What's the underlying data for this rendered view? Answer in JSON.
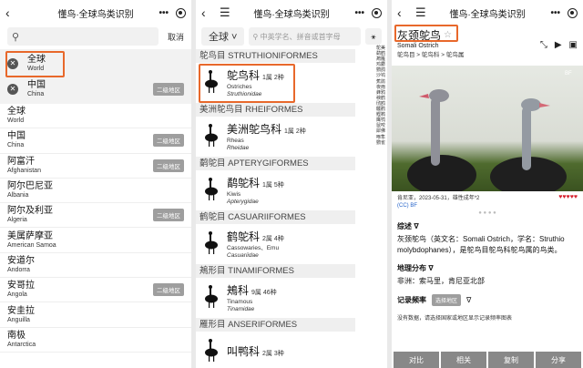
{
  "app_title": "懂鸟·全球鸟类识别",
  "screen1": {
    "search_placeholder": "",
    "cancel": "取消",
    "selected": [
      {
        "cn": "全球",
        "en": "World"
      },
      {
        "cn": "中国",
        "en": "China",
        "tag": "二级地区"
      }
    ],
    "regions": [
      {
        "cn": "全球",
        "en": "World"
      },
      {
        "cn": "中国",
        "en": "China",
        "tag": "二级地区"
      },
      {
        "cn": "阿富汗",
        "en": "Afghanistan",
        "tag": "二级地区"
      },
      {
        "cn": "阿尔巴尼亚",
        "en": "Albania"
      },
      {
        "cn": "阿尔及利亚",
        "en": "Algeria",
        "tag": "二级地区"
      },
      {
        "cn": "美属萨摩亚",
        "en": "American Samoa"
      },
      {
        "cn": "安道尔",
        "en": "Andorra"
      },
      {
        "cn": "安哥拉",
        "en": "Angola",
        "tag": "二级地区"
      },
      {
        "cn": "安圭拉",
        "en": "Anguilla"
      },
      {
        "cn": "南极",
        "en": "Antarctica"
      }
    ]
  },
  "screen2": {
    "region_btn": "全球 ˅",
    "search_placeholder": "中英学名、拼音或首字母",
    "groups": [
      {
        "order": "鸵鸟目 STRUTHIONIFORMES",
        "cn": "鸵鸟科",
        "count": "1属 2种",
        "en": "Ostriches",
        "sci": "Struthionidae"
      },
      {
        "order": "美洲鸵鸟目 RHEIFORMES",
        "cn": "美洲鸵鸟科",
        "count": "1属 2种",
        "en": "Rheas",
        "sci": "Rheidae"
      },
      {
        "order": "鹬鸵目 APTERYGIFORMES",
        "cn": "鹬鸵科",
        "count": "1属 5种",
        "en": "Kiwis",
        "sci": "Apterygidae"
      },
      {
        "order": "鹤鸵目 CASUARIIFORMES",
        "cn": "鹤鸵科",
        "count": "2属 4种",
        "en": "Cassowaries、Emu",
        "sci": "Casuariidae"
      },
      {
        "order": "鴂形目 TINAMIFORMES",
        "cn": "鴂科",
        "count": "9属 46种",
        "en": "Tinamous",
        "sci": "Tinamidae"
      },
      {
        "order": "雁形目 ANSERIFORMES",
        "cn": "叫鸭科",
        "count": "2属 3种",
        "en": "",
        "sci": ""
      }
    ],
    "index": "鸵美鹬鹤鴂雁鸡麝鹦鸽沙鸨蕉鹃夜雨蜂鸦秧鹤鸻鸥鸌鹳鲣鹈鹰鸮鼠咬犀佛啄隼鹦雀"
  },
  "screen3": {
    "cn": "灰颈鸵鸟",
    "en": "Somali Ostrich",
    "breadcrumb": "鸵鸟目 > 鸵鸟科 > 鸵鸟属",
    "badge": "BF",
    "credit": "肯尼亚，2023-05-31，雄性成年*2",
    "hearts": "♥♥♥♥♥",
    "license": "(CC) BF",
    "summary_title": "综述 ∇",
    "summary": "灰颈鸵鸟（英文名：Somali Ostrich，学名：Struthio molybdophanes），是鸵鸟目鸵鸟科鸵鸟属的鸟类。",
    "dist_title": "地理分布 ∇",
    "dist": "非洲：索马里，肯尼亚北部",
    "freq_title": "记录频率",
    "freq_btn": "选择地区",
    "freq_arrow": "∇",
    "note": "没有数据，请选择国家或地区显示记录频率图表",
    "buttons": [
      "对比",
      "相关",
      "复制",
      "分享"
    ]
  }
}
